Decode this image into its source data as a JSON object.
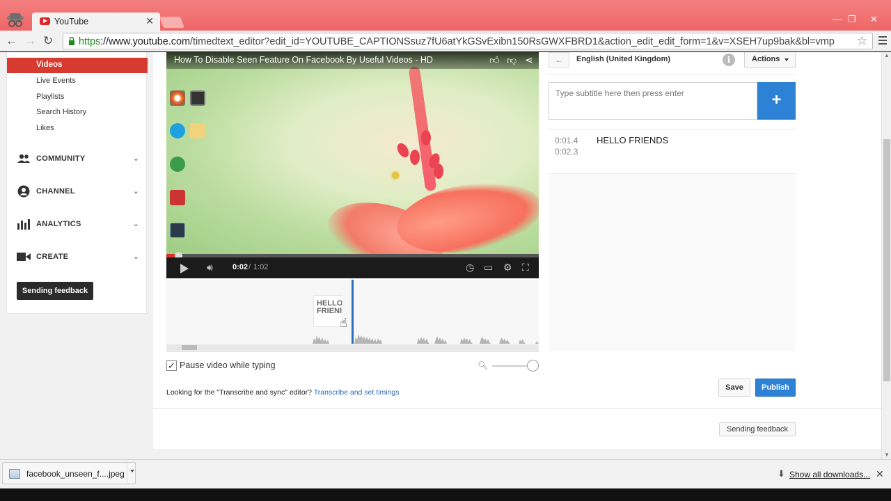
{
  "browser": {
    "tab_title": "YouTube",
    "tab_close": "✕",
    "url_scheme": "https",
    "url_host": "://www.youtube.com",
    "url_path": "/timedtext_editor?edit_id=YOUTUBE_CAPTIONSsuz7fU6atYkGSvExibn150RsGWXFBRD1&action_edit_edit_form=1&v=XSEH7up9bak&bl=vmp",
    "window_controls": [
      "—",
      "❐",
      "✕"
    ]
  },
  "sidebar": {
    "active_item": "Videos",
    "sub_items": [
      "Live Events",
      "Playlists",
      "Search History",
      "Likes"
    ],
    "sections": [
      {
        "label": "COMMUNITY",
        "icon": "people-icon"
      },
      {
        "label": "CHANNEL",
        "icon": "account-circle-icon"
      },
      {
        "label": "ANALYTICS",
        "icon": "bar-chart-icon"
      },
      {
        "label": "CREATE",
        "icon": "video-camera-icon"
      }
    ],
    "feedback_button": "Sending feedback"
  },
  "video": {
    "title": "How To Disable Seen Feature On Facebook By Useful Videos - HD",
    "time_current": "0:02",
    "time_separator": "/",
    "time_total": "1:02",
    "progress_fraction": 0.032
  },
  "timeline": {
    "caption_preview": "HELLO FRIENI"
  },
  "options": {
    "pause_label": "Pause video while typing",
    "pause_checked": true,
    "transcribe_prompt": "Looking for the \"Transcribe and sync\" editor?",
    "transcribe_link": "Transcribe and set timings"
  },
  "editor": {
    "back_arrow": "←",
    "language": "English (United Kingdom)",
    "info_icon_glyph": "i",
    "actions_label": "Actions",
    "subtitle_placeholder": "Type subtitle here then press enter",
    "add_glyph": "+",
    "cues": [
      {
        "start": "0:01.4",
        "end": "0:02.3",
        "text": "HELLO FRIENDS"
      }
    ],
    "save_label": "Save",
    "publish_label": "Publish"
  },
  "footer": {
    "feedback_button": "Sending feedback"
  },
  "downloads": {
    "file_name": "facebook_unseen_f....jpeg",
    "show_all": "Show all downloads..."
  },
  "colors": {
    "browser_frame": "#ef6767",
    "youtube_red": "#d73a2f",
    "primary_blue": "#2d82d6",
    "playhead_blue": "#2b6fc2"
  }
}
